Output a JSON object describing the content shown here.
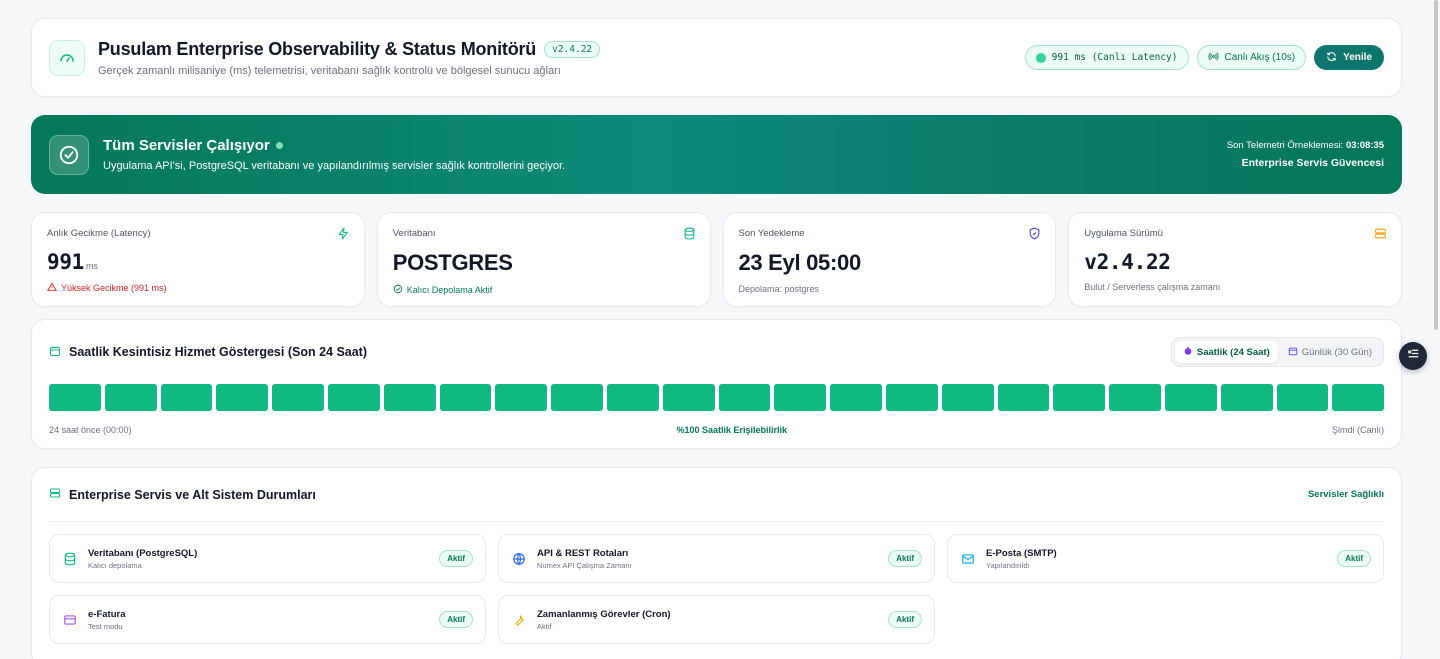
{
  "header": {
    "title": "Pusulam Enterprise Observability & Status Monitörü",
    "version": "v2.4.22",
    "subtitle": "Gerçek zamanlı milisaniye (ms) telemetrisi, veritabanı sağlık kontrolü ve bölgesel sunucu ağları",
    "latency_pill": "991 ms (Canlı Latency)",
    "live_pill": "Canlı Akış (10s)",
    "refresh_label": "Yenile",
    "icon": "gauge-icon"
  },
  "banner": {
    "title": "Tüm Servisler Çalışıyor",
    "subtitle": "Uygulama API'si, PostgreSQL veritabanı ve yapılandırılmış servisler sağlık kontrollerini geçiyor.",
    "last_sample_label": "Son Telemetri Örneklemesi:",
    "last_sample_time": "03:08:35",
    "assurance": "Enterprise Servis Güvencesi",
    "colors": {
      "start": "#047857",
      "end": "#0f8a7a"
    }
  },
  "stats": [
    {
      "label": "Anlık Gecikme (Latency)",
      "value": "991",
      "unit": "ms",
      "note": "Yüksek Gecikme (991 ms)",
      "icon": "bolt-icon"
    },
    {
      "label": "Veritabanı",
      "value": "POSTGRES",
      "note": "Kalıcı Depolama Aktif",
      "icon": "database-icon"
    },
    {
      "label": "Son Yedekleme",
      "value": "23 Eyl 05:00",
      "note": "Depolama: postgres",
      "icon": "shield-icon"
    },
    {
      "label": "Uygulama Sürümü",
      "value": "v2.4.22",
      "note": "Bulut / Serverless çalışma zamanı",
      "icon": "server-icon"
    }
  ],
  "uptime": {
    "title": "Saatlik Kesintisiz Hizmet Göstergesi (Son 24 Saat)",
    "tab_hourly": "Saatlik (24 Saat)",
    "tab_daily": "Günlük (30 Gün)",
    "bar_count": 24,
    "bar_color": "#10b981",
    "start_label": "24 saat önce (00:00)",
    "availability": "%100 Saatlik Erişilebilirlik",
    "end_label": "Şimdi (Canlı)"
  },
  "services": {
    "title": "Enterprise Servis ve Alt Sistem Durumları",
    "link": "Servisler Sağlıklı",
    "items": [
      {
        "name": "Veritabanı (PostgreSQL)",
        "sub": "Kalıcı depolama",
        "status": "Aktif",
        "icon": "database-icon"
      },
      {
        "name": "API & REST Rotaları",
        "sub": "Numex API Çalışma Zamanı",
        "status": "Aktif",
        "icon": "globe-icon"
      },
      {
        "name": "E-Posta (SMTP)",
        "sub": "Yapılandırıldı",
        "status": "Aktif",
        "icon": "mail-icon"
      },
      {
        "name": "e-Fatura",
        "sub": "Test modu",
        "status": "Aktif",
        "icon": "card-icon"
      },
      {
        "name": "Zamanlanmış Görevler (Cron)",
        "sub": "Aktif",
        "status": "Aktif",
        "icon": "wrench-icon"
      }
    ]
  }
}
